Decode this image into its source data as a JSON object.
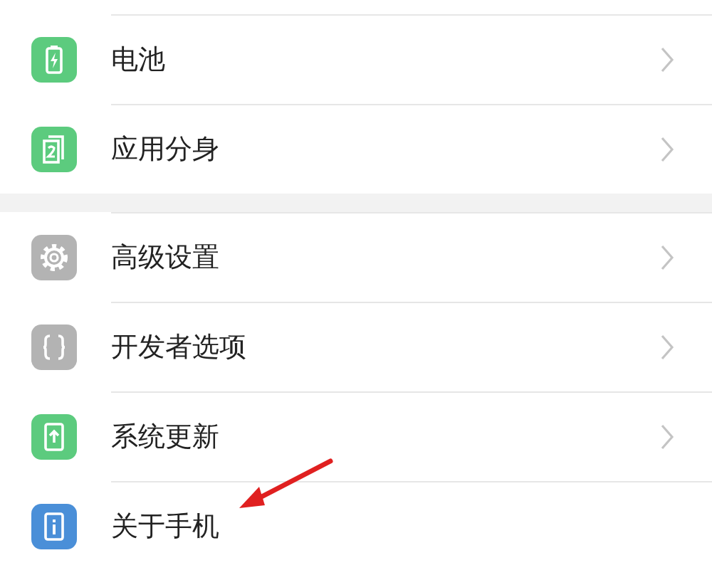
{
  "groups": [
    {
      "items": [
        {
          "label": "电池",
          "kind": "battery",
          "color": "#5ccb7e",
          "chevron": true
        },
        {
          "label": "应用分身",
          "kind": "clone",
          "color": "#5ccb7e",
          "chevron": true
        }
      ]
    },
    {
      "items": [
        {
          "label": "高级设置",
          "kind": "gear",
          "color": "#b3b3b3",
          "chevron": true
        },
        {
          "label": "开发者选项",
          "kind": "braces",
          "color": "#b3b3b3",
          "chevron": true
        },
        {
          "label": "系统更新",
          "kind": "update",
          "color": "#5ccb7e",
          "chevron": true
        },
        {
          "label": "关于手机",
          "kind": "info",
          "color": "#4a8fd8",
          "chevron": false
        }
      ]
    }
  ],
  "annotation": {
    "kind": "arrow"
  }
}
